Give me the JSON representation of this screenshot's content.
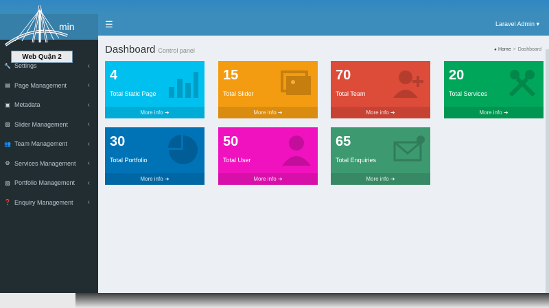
{
  "brand": {
    "text": "min"
  },
  "navbar": {
    "toggle_icon": "☰",
    "user": "Laravel Admin ▾"
  },
  "watermark": {
    "text": "Web Quận 2"
  },
  "sidebar": {
    "items": [
      {
        "icon": "wrench-icon",
        "glyph": "🔧",
        "label": "Settings"
      },
      {
        "icon": "file-icon",
        "glyph": "▤",
        "label": "Page Management"
      },
      {
        "icon": "list-icon",
        "glyph": "▣",
        "label": "Metadata"
      },
      {
        "icon": "image-icon",
        "glyph": "▨",
        "label": "Slider Management"
      },
      {
        "icon": "users-icon",
        "glyph": "👥",
        "label": "Team Management"
      },
      {
        "icon": "cogs-icon",
        "glyph": "⚙",
        "label": "Services Management"
      },
      {
        "icon": "picture-icon",
        "glyph": "▨",
        "label": "Portfolio Management"
      },
      {
        "icon": "question-icon",
        "glyph": "❓",
        "label": "Enquiry Management"
      }
    ],
    "chevron": "‹"
  },
  "header": {
    "title": "Dashboard",
    "subtitle": "Control panel"
  },
  "breadcrumb": {
    "home": "Home",
    "separator": ">",
    "current": "Dashboard"
  },
  "boxes": [
    {
      "number": "4",
      "label": "Total Static Page",
      "footer": "More info ➜",
      "color": "#00c0ef",
      "icon": "bar-chart-icon"
    },
    {
      "number": "15",
      "label": "Total Slider",
      "footer": "More info ➜",
      "color": "#f39c12",
      "icon": "images-icon"
    },
    {
      "number": "70",
      "label": "Total Team",
      "footer": "More info ➜",
      "color": "#dd4b39",
      "icon": "user-plus-icon"
    },
    {
      "number": "20",
      "label": "Total Services",
      "footer": "More info ➜",
      "color": "#00a65a",
      "icon": "tools-icon"
    },
    {
      "number": "30",
      "label": "Total Portfolio",
      "footer": "More info ➜",
      "color": "#0073b7",
      "icon": "pie-chart-icon"
    },
    {
      "number": "50",
      "label": "Total User",
      "footer": "More info ➜",
      "color": "#f012be",
      "icon": "user-icon"
    },
    {
      "number": "65",
      "label": "Total Enquiries",
      "footer": "More info ➜",
      "color": "#3d9970",
      "icon": "envelope-icon"
    }
  ]
}
